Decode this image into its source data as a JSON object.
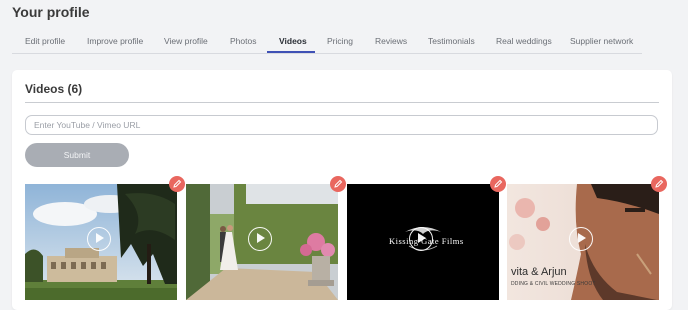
{
  "page": {
    "title": "Your profile"
  },
  "tabs": [
    {
      "label": "Edit profile",
      "active": false
    },
    {
      "label": "Improve profile",
      "active": false
    },
    {
      "label": "View profile",
      "active": false
    },
    {
      "label": "Photos",
      "active": false
    },
    {
      "label": "Videos",
      "active": true
    },
    {
      "label": "Pricing",
      "active": false
    },
    {
      "label": "Reviews",
      "active": false
    },
    {
      "label": "Testimonials",
      "active": false
    },
    {
      "label": "Real weddings",
      "active": false
    },
    {
      "label": "Supplier network",
      "active": false
    }
  ],
  "videos": {
    "heading": "Videos (6)",
    "url_input": {
      "placeholder": "Enter YouTube / Vimeo URL",
      "value": ""
    },
    "submit_label": "Submit",
    "items": [
      {
        "overlay_lines": []
      },
      {
        "overlay_lines": []
      },
      {
        "overlay_lines": [
          "Kissing Gate Films"
        ]
      },
      {
        "overlay_lines": [
          "vita & Arjun",
          "DDING & CIVIL WEDDING SHOOT"
        ]
      }
    ]
  },
  "colors": {
    "accent": "#3f51b5",
    "edit_button": "#e9675f",
    "submit_disabled": "#a9adb4"
  },
  "icons": {
    "edit": "pencil-icon",
    "play": "play-icon"
  }
}
